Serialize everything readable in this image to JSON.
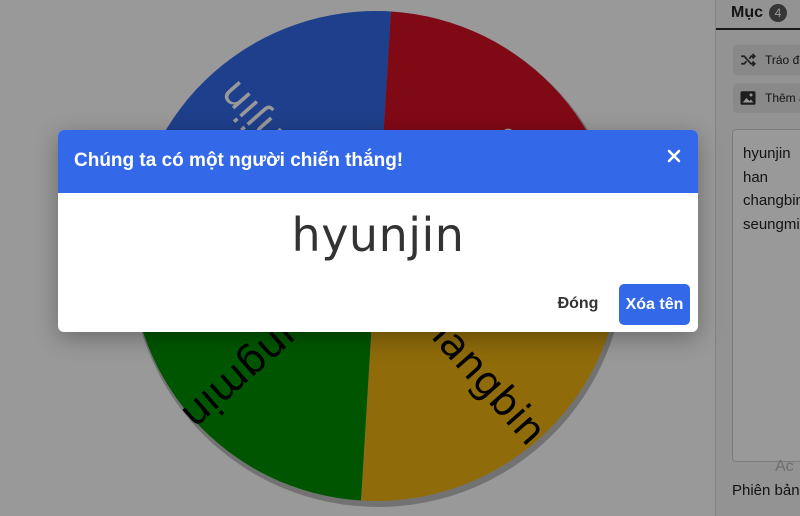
{
  "wheel": {
    "slices": [
      {
        "label": "seungmin",
        "color": "#008f00"
      },
      {
        "label": "hyunjin",
        "color": "#3369e8"
      },
      {
        "label": "han",
        "color": "#d50f25"
      },
      {
        "label": "changbin",
        "color": "#eeb211"
      }
    ]
  },
  "panel": {
    "tab_label": "Mục",
    "tab_count": "4",
    "shuffle_label": "Tráo đ",
    "add_image_label": "Thêm ả",
    "entries": [
      "hyunjin",
      "han",
      "changbin",
      "seungmi"
    ],
    "version_text": "Phiên bản",
    "watermark": "Ac"
  },
  "dialog": {
    "title": "Chúng ta có một người chiến thắng!",
    "winner": "hyunjin",
    "close_label": "Đóng",
    "remove_label": "Xóa tên"
  },
  "colors": {
    "header_blue": "#3369e8",
    "overlay": "rgba(0,0,0,0.40)"
  }
}
